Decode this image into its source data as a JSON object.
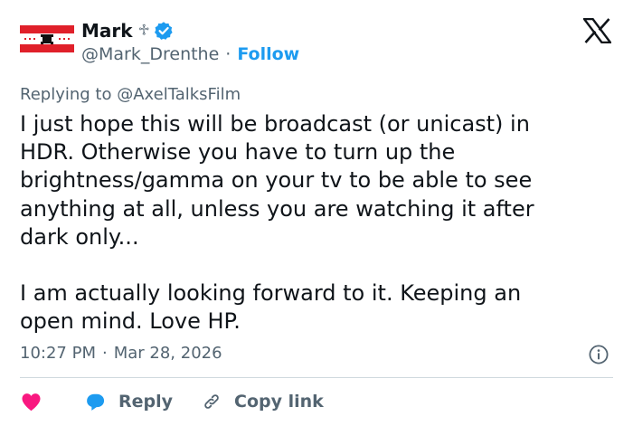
{
  "author": {
    "display_name": "Mark",
    "name_emoji": "♱",
    "handle": "@Mark_Drenthe",
    "separator": "·",
    "follow_label": "Follow",
    "verified": true
  },
  "reply_context": {
    "prefix": "Replying to",
    "mention": "@AxelTalksFilm"
  },
  "tweet": {
    "text": "I just hope this will be broadcast (or unicast) in\nHDR. Otherwise you have to turn up the\nbrightness/gamma on your tv to be able to see\nanything at all, unless you are watching it after\ndark only...\n\nI am actually looking forward to it. Keeping an\nopen mind. Love HP.",
    "time": "10:27 PM",
    "separator": "·",
    "date": "Mar 28, 2026"
  },
  "actions": {
    "reply_label": "Reply",
    "copy_link_label": "Copy link"
  },
  "colors": {
    "accent": "#1d9bf0",
    "like": "#f91880",
    "text": "#0f1419",
    "secondary_text": "#536471",
    "divider": "#cfd9de",
    "flag_red": "#e0202a"
  },
  "icons": {
    "brand": "x-logo-icon",
    "verified": "verified-badge-icon",
    "info": "info-icon",
    "like": "heart-icon",
    "reply": "speech-bubble-icon",
    "copy_link": "link-icon"
  }
}
